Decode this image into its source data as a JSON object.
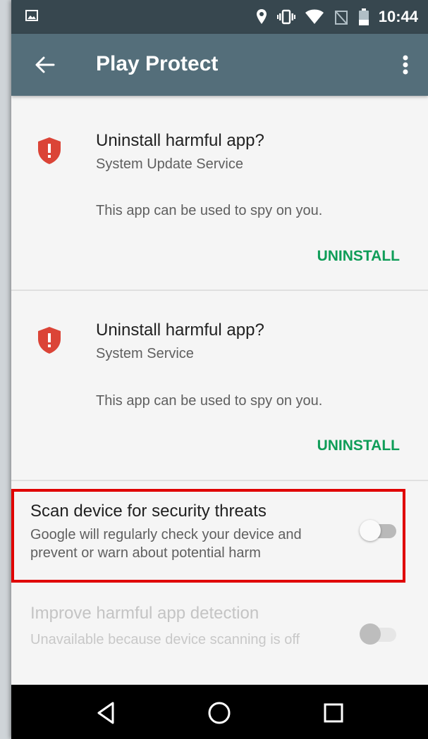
{
  "status_bar": {
    "time": "10:44"
  },
  "app_bar": {
    "title": "Play Protect"
  },
  "cards": [
    {
      "title": "Uninstall harmful app?",
      "app_name": "System Update Service",
      "description": "This app can be used to spy on you.",
      "action": "UNINSTALL"
    },
    {
      "title": "Uninstall harmful app?",
      "app_name": "System Service",
      "description": "This app can be used to spy on you.",
      "action": "UNINSTALL"
    }
  ],
  "settings": {
    "scan": {
      "title": "Scan device for security threats",
      "subtitle": "Google will regularly check your device and prevent or warn about potential harm",
      "enabled": false
    },
    "improve": {
      "title": "Improve harmful app detection",
      "subtitle": "Unavailable because device scanning is off",
      "enabled": false,
      "disabled": true
    }
  },
  "colors": {
    "status_bar": "#37474f",
    "app_bar": "#546e7a",
    "accent_green": "#0f9d58",
    "shield_red": "#db4437",
    "highlight_red": "#e00000"
  },
  "icons": [
    "image-icon",
    "location-icon",
    "vibrate-icon",
    "wifi-icon",
    "no-sim-icon",
    "battery-icon",
    "back-arrow-icon",
    "more-vert-icon",
    "shield-alert-icon",
    "nav-back-icon",
    "nav-home-icon",
    "nav-recents-icon"
  ]
}
